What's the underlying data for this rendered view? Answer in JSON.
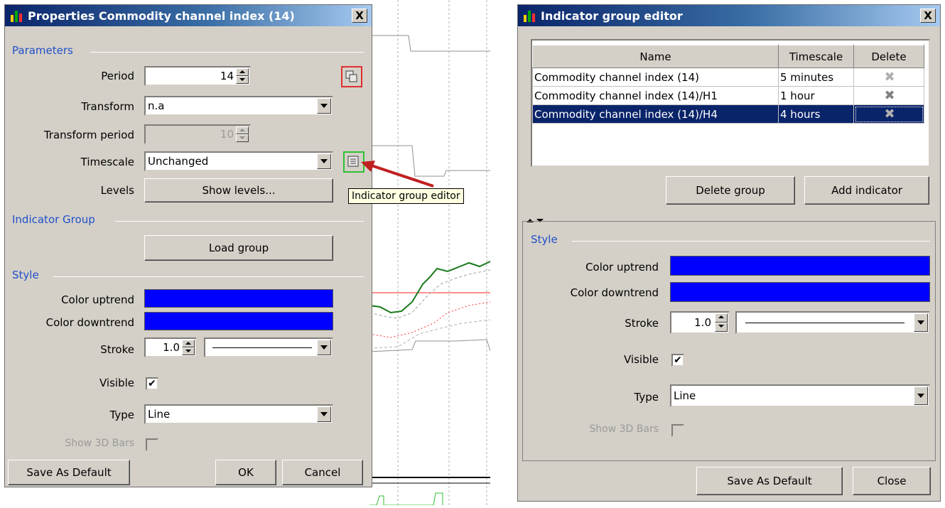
{
  "left_dialog": {
    "title": "Properties Commodity channel index (14)",
    "close_glyph": "X",
    "parameters_section": "Parameters",
    "period_label": "Period",
    "period_value": "14",
    "transform_label": "Transform",
    "transform_value": "n.a",
    "transform_period_label": "Transform period",
    "transform_period_value": "10",
    "timescale_label": "Timescale",
    "timescale_value": "Unchanged",
    "levels_label": "Levels",
    "show_levels_button": "Show levels...",
    "indicator_group_section": "Indicator Group",
    "load_group_button": "Load group",
    "style_section": "Style",
    "color_uptrend_label": "Color uptrend",
    "color_downtrend_label": "Color downtrend",
    "stroke_label": "Stroke",
    "stroke_value": "1.0",
    "visible_label": "Visible",
    "visible_checked": "✔",
    "type_label": "Type",
    "type_value": "Line",
    "show_3d_bars_label": "Show 3D Bars",
    "save_default_button": "Save As Default",
    "ok_button": "OK",
    "cancel_button": "Cancel"
  },
  "tooltip": {
    "text": "Indicator group editor"
  },
  "right_dialog": {
    "title": "Indicator group editor",
    "close_glyph": "X",
    "table_headers": [
      "Name",
      "Timescale",
      "Delete"
    ],
    "table_rows": [
      {
        "name": "Commodity channel index (14)",
        "timescale": "5 minutes"
      },
      {
        "name": "Commodity channel index (14)/H1",
        "timescale": "1 hour"
      },
      {
        "name": "Commodity channel index (14)/H4",
        "timescale": "4 hours"
      }
    ],
    "delete_glyph": "✖",
    "delete_group_button": "Delete group",
    "add_indicator_button": "Add indicator",
    "style_section": "Style",
    "color_uptrend_label": "Color uptrend",
    "color_downtrend_label": "Color downtrend",
    "stroke_label": "Stroke",
    "stroke_value": "1.0",
    "visible_label": "Visible",
    "visible_checked": "✔",
    "type_label": "Type",
    "type_value": "Line",
    "show_3d_bars_label": "Show 3D Bars",
    "save_default_button": "Save As Default",
    "close_button": "Close"
  },
  "colors": {
    "swatch": "#0000ff",
    "section_label": "#2050c8",
    "selected_row": "#0a246a"
  }
}
